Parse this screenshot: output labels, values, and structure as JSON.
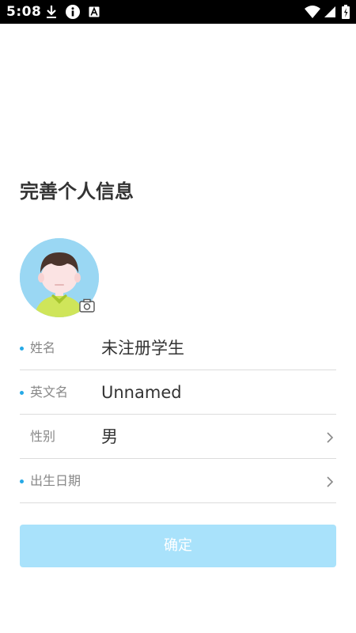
{
  "status_bar": {
    "time": "5:08",
    "icons": [
      "download-icon",
      "info-icon",
      "a-badge-icon",
      "wifi-icon",
      "signal-icon",
      "battery-icon"
    ]
  },
  "page": {
    "title": "完善个人信息"
  },
  "avatar": {
    "icon": "avatar-illustration",
    "camera_icon": "camera-icon"
  },
  "form": {
    "rows": [
      {
        "label": "姓名",
        "value": "未注册学生",
        "required": true,
        "has_chevron": false
      },
      {
        "label": "英文名",
        "value": "Unnamed",
        "required": true,
        "has_chevron": false
      },
      {
        "label": "性别",
        "value": "男",
        "required": false,
        "has_chevron": true
      },
      {
        "label": "出生日期",
        "value": "",
        "required": true,
        "has_chevron": true
      }
    ]
  },
  "confirm": {
    "label": "确定"
  },
  "colors": {
    "accent": "#26a9e6",
    "button_disabled": "#a9e2fb",
    "avatar_bg": "#9ad7f3"
  }
}
